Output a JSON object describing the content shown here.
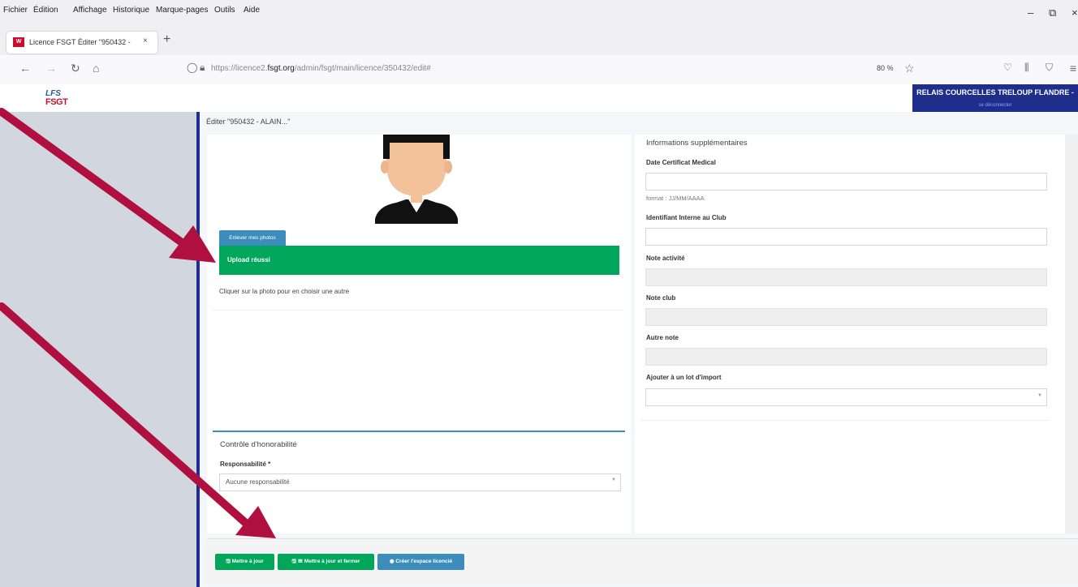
{
  "browser": {
    "menu": [
      "Fichier",
      "Édition",
      "Affichage",
      "Historique",
      "Marque-pages",
      "Outils",
      "Aide"
    ],
    "tab_title": "Licence FSGT Éditer \"950432 - ",
    "tab_close": "×",
    "new_tab": "+",
    "url_prefix": "https://licence2.",
    "url_domain": "fsgt.org",
    "url_path": "/admin/fsgt/main/licence/350432/edit#",
    "zoom": "80 %"
  },
  "header": {
    "logo_line1": "LFS",
    "logo_line2": "FSGT",
    "club_name": "RELAIS COURCELLES TRELOUP FLANDRE -",
    "logout": "se déconnecter"
  },
  "page": {
    "title": "Éditer \"950432 - ALAIN...\""
  },
  "photo": {
    "remove_label": "Enlever mes photos",
    "upload_success": "Upload réussi",
    "hint": "Cliquer sur la photo pour en choisir une autre"
  },
  "honor": {
    "title": "Contrôle d'honorabilité",
    "resp_label": "Responsabilité *",
    "resp_value": "Aucune responsabilité"
  },
  "info": {
    "title": "Informations supplémentaires",
    "date_label": "Date Certificat Medical",
    "date_help": "format : JJ/MM/AAAA",
    "club_id_label": "Identifiant Interne au Club",
    "activity_note_label": "Note activité",
    "club_note_label": "Note club",
    "other_note_label": "Autre note",
    "import_lot_label": "Ajouter à un lot d'import"
  },
  "footer": {
    "update": "Mettre à jour",
    "update_close": "Mettre à jour et fermer",
    "create_space": "Créer l'espace licencié"
  },
  "colors": {
    "arrow": "#b0103f",
    "success": "#00a65a",
    "primary": "#3c8dbc",
    "club_bg": "#1f2d8b"
  }
}
